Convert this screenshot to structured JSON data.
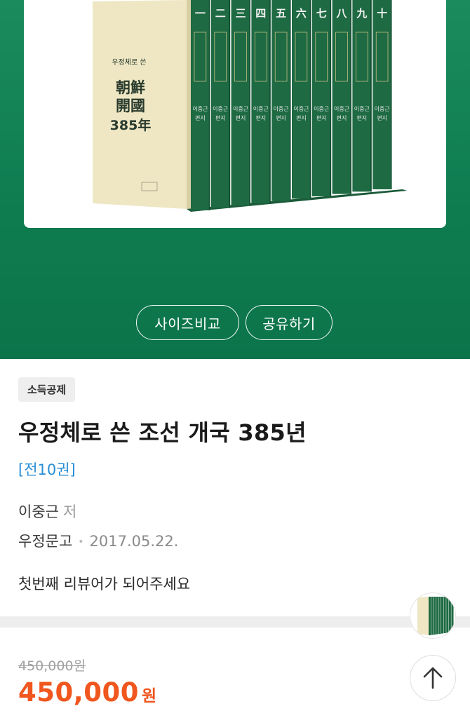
{
  "hero": {
    "cover_box_title": "우정체로 쓴",
    "cover_box_hanja": "朝鮮開國",
    "cover_box_year": "385年",
    "spine_numerals": [
      "一",
      "二",
      "三",
      "四",
      "五",
      "六",
      "七",
      "八",
      "九",
      "十"
    ],
    "spine_author": "이중근",
    "spine_subtitle": "편지",
    "colors": {
      "background": "#0f7d50",
      "spine": "#1e6a43",
      "box": "#efe7c4"
    },
    "buttons": {
      "size_compare": "사이즈비교",
      "share": "공유하기"
    }
  },
  "product": {
    "badge": "소득공제",
    "title": "우정체로 쓴 조선 개국 385년",
    "volumes": "[전10권]",
    "author": "이중근",
    "author_role": "저",
    "publisher": "우정문고",
    "separator": "•",
    "pub_date": "2017.05.22.",
    "review_prompt": "첫번째 리뷰어가 되어주세요"
  },
  "price": {
    "original": "450,000원",
    "sale": "450,000",
    "sale_unit": "원",
    "accent_color": "#f0561e"
  },
  "floating": {
    "thumbnail_icon": "book-cover-thumbnail",
    "top_button_icon": "arrow-up-icon"
  }
}
